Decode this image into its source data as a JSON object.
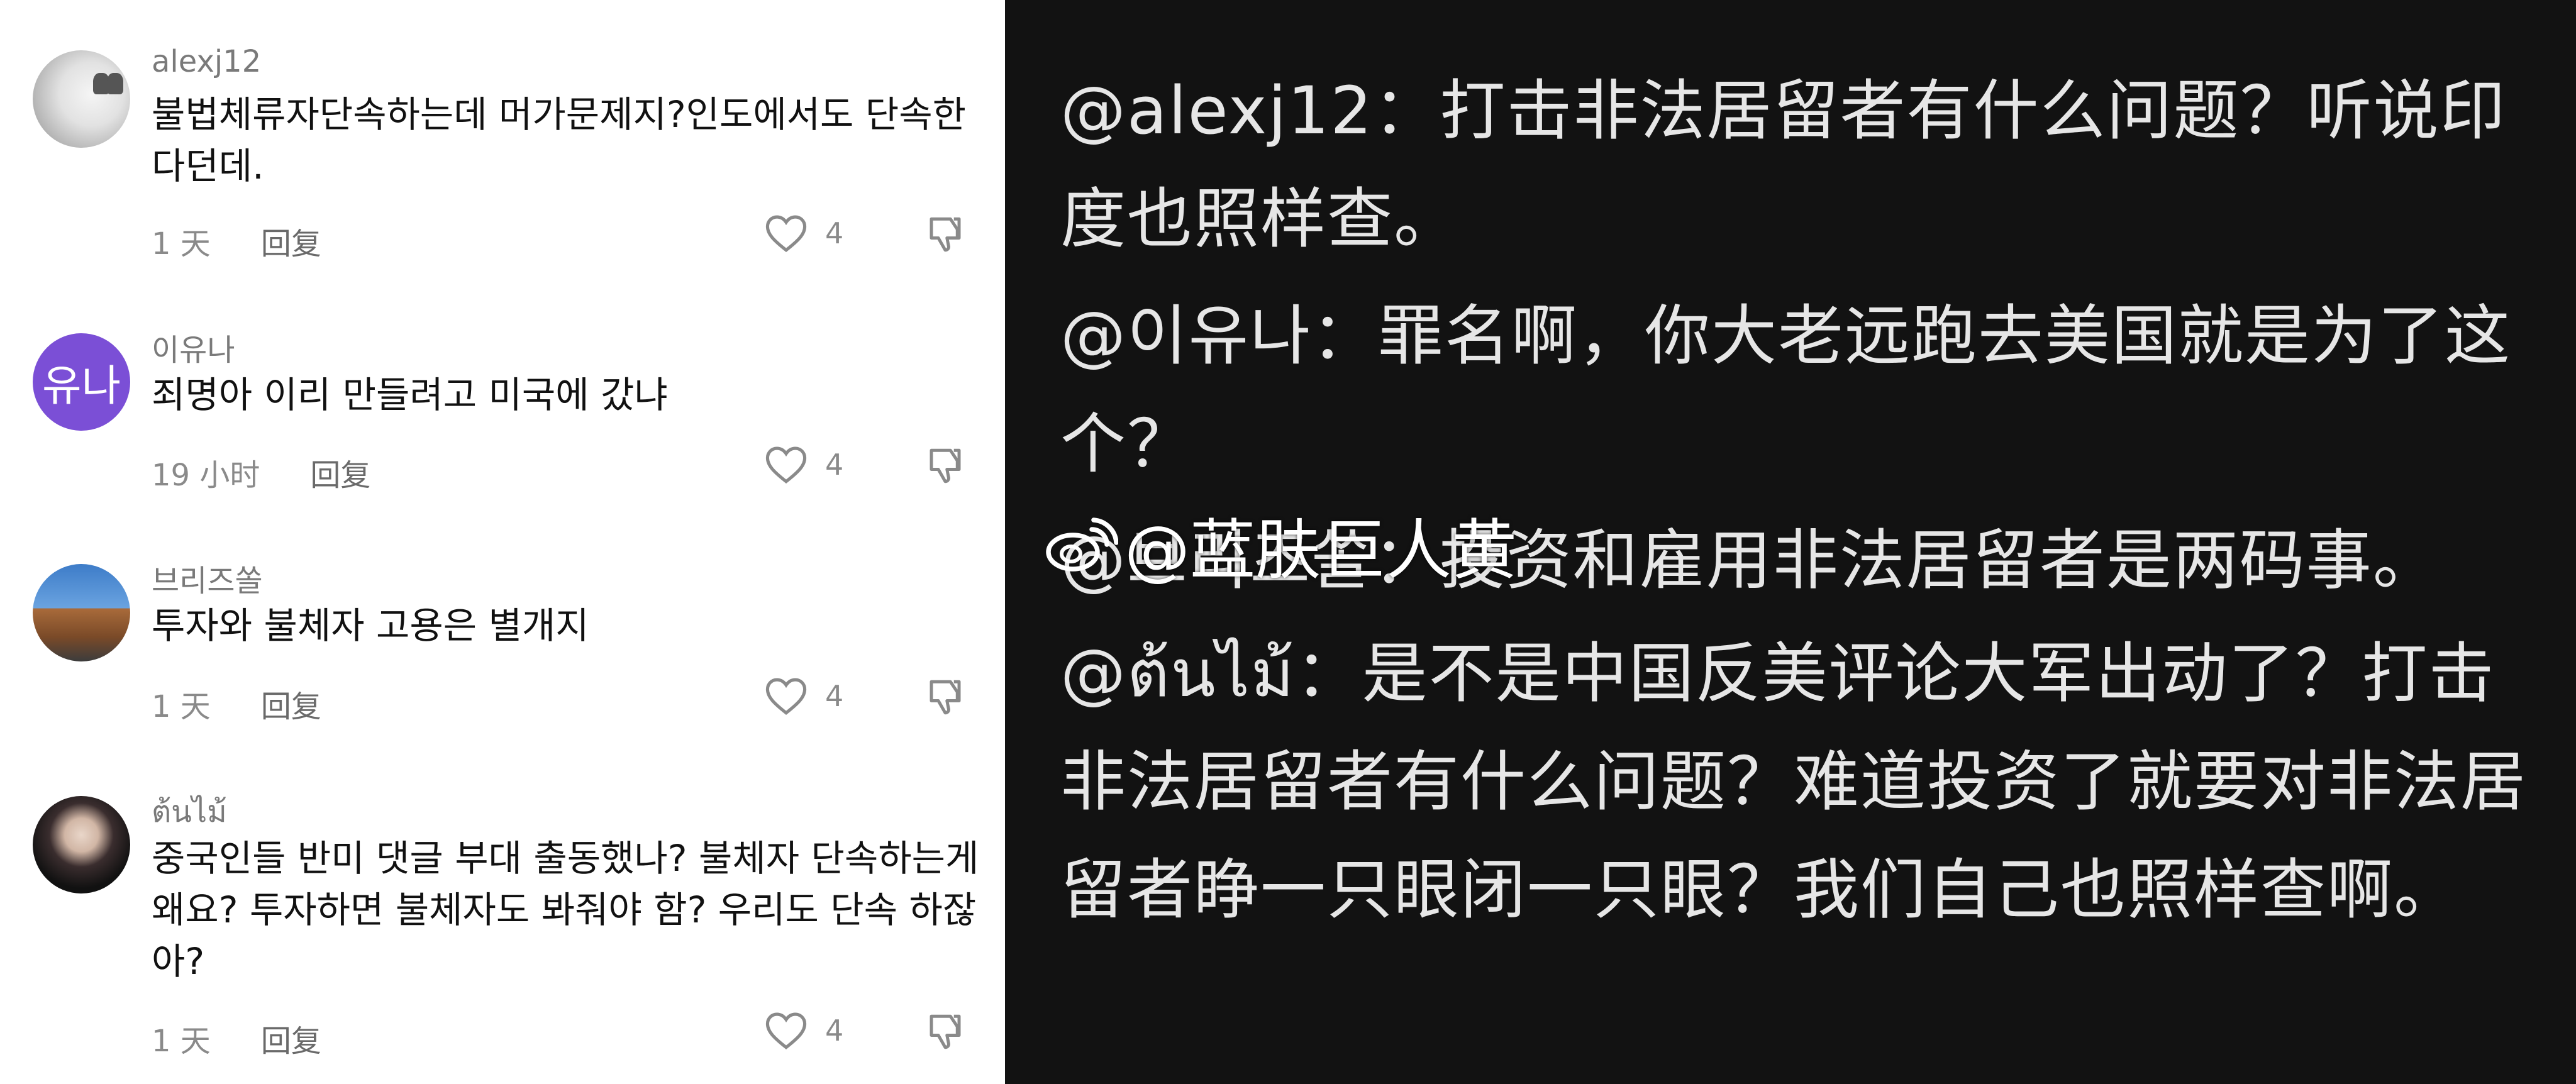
{
  "left_panel": {
    "comments": [
      {
        "username": "alexj12",
        "text": "불법체류자단속하는데 머가문제지?인도에서도 단속한다던데.",
        "time": "1 天",
        "reply_label": "回复",
        "likes": "4",
        "avatar": "cat-photo"
      },
      {
        "username": "이유나",
        "text": "죄명아 이리 만들려고 미국에 갔냐",
        "time": "19 小时",
        "reply_label": "回复",
        "likes": "4",
        "avatar_text": "유나",
        "avatar_color": "#7b4fd6"
      },
      {
        "username": "브리즈쏠",
        "text": "투자와 불체자 고용은 별개지",
        "time": "1 天",
        "reply_label": "回复",
        "likes": "4",
        "avatar": "building-photo"
      },
      {
        "username": "ต้นไม้",
        "text": "중국인들 반미 댓글 부대 출동했나? 불체자 단속하는게 왜요? 투자하면 불체자도 봐줘야 함? 우리도 단속 하잖아?",
        "time": "1 天",
        "reply_label": "回复",
        "likes": "4",
        "avatar": "person-photo"
      }
    ]
  },
  "right_panel": {
    "paragraphs": [
      "@alexj12：打击非法居留者有什么问题？听说印度也照样查。",
      "@이유나：罪名啊，你大老远跑去美国就是为了这个？",
      "@브리즈쏠：投资和雇用非法居留者是两码事。",
      "@ต้นไม้：是不是中国反美评论大军出动了？打击非法居留者有什么问题？难道投资了就要对非法居留者睁一只眼闭一只眼？我们自己也照样查啊。"
    ]
  },
  "watermark": {
    "text": "@蓝肤巨人黄",
    "icon": "weibo-icon"
  },
  "colors": {
    "left_bg": "#ffffff",
    "right_bg": "#121212",
    "right_text": "#e6e6e6",
    "meta_text": "#8a8a8a"
  }
}
